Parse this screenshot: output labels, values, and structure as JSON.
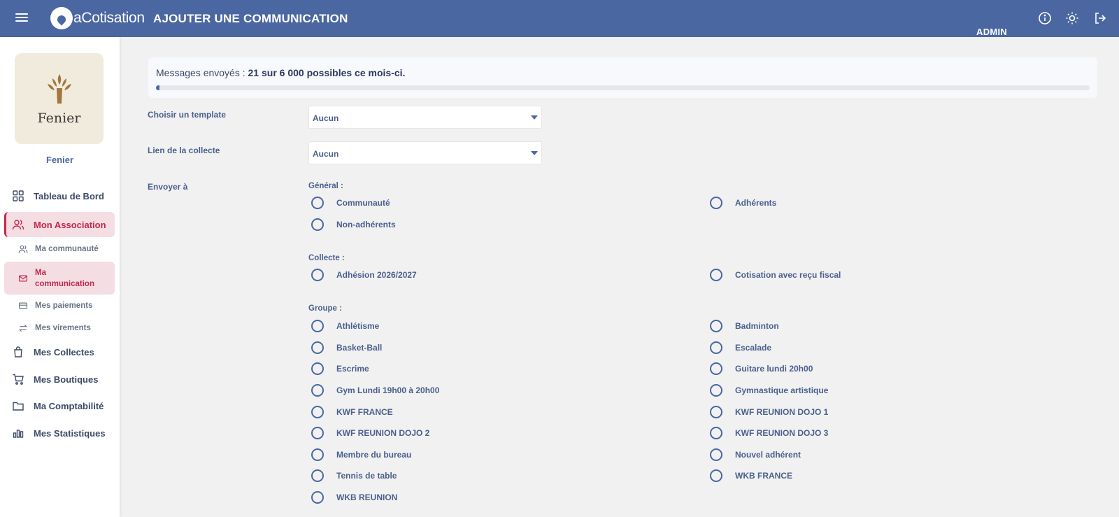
{
  "app": {
    "logo_text": "aCotisation",
    "page_title": "AJOUTER UNE COMMUNICATION",
    "user_role": "ADMIN"
  },
  "sidebar": {
    "org_card_text": "Fenier",
    "org_name": "Fenier",
    "items": [
      {
        "label": "Tableau de Bord",
        "icon": "grid-icon"
      },
      {
        "label": "Mon Association",
        "icon": "users-icon"
      },
      {
        "label": "Ma communauté",
        "icon": "users-icon"
      },
      {
        "label": "Ma communication",
        "icon": "mail-icon"
      },
      {
        "label": "Mes paiements",
        "icon": "card-icon"
      },
      {
        "label": "Mes virements",
        "icon": "transfer-icon"
      },
      {
        "label": "Mes Collectes",
        "icon": "bag-icon"
      },
      {
        "label": "Mes Boutiques",
        "icon": "cart-icon"
      },
      {
        "label": "Ma Comptabilité",
        "icon": "folder-icon"
      },
      {
        "label": "Mes Statistiques",
        "icon": "bar-chart-icon"
      }
    ]
  },
  "messages": {
    "prefix": "Messages envoyés : ",
    "count_text": "21 sur 6 000 possibles ce mois-ci.",
    "used": 21,
    "limit": 6000
  },
  "form": {
    "template_label": "Choisir un template",
    "template_value": "Aucun",
    "collecte_link_label": "Lien de la collecte",
    "collecte_link_value": "Aucun",
    "send_to_label": "Envoyer à",
    "general": {
      "title": "Général :",
      "options": [
        "Communauté",
        "Adhérents",
        "Non-adhérents"
      ]
    },
    "collecte": {
      "title": "Collecte :",
      "options": [
        "Adhésion 2026/2027",
        "Cotisation avec reçu fiscal"
      ]
    },
    "groupe": {
      "title": "Groupe :",
      "options": [
        "Athlétisme",
        "Badminton",
        "Basket-Ball",
        "Escalade",
        "Escrime",
        "Guitare lundi 20h00",
        "Gym Lundi 19h00 à 20h00",
        "Gymnastique artistique",
        "KWF FRANCE",
        "KWF REUNION DOJO 1",
        "KWF REUNION DOJO 2",
        "KWF REUNION DOJO 3",
        "Membre du bureau",
        "Nouvel adhérent",
        "Tennis de table",
        "WKB FRANCE",
        "WKB REUNION"
      ]
    }
  }
}
